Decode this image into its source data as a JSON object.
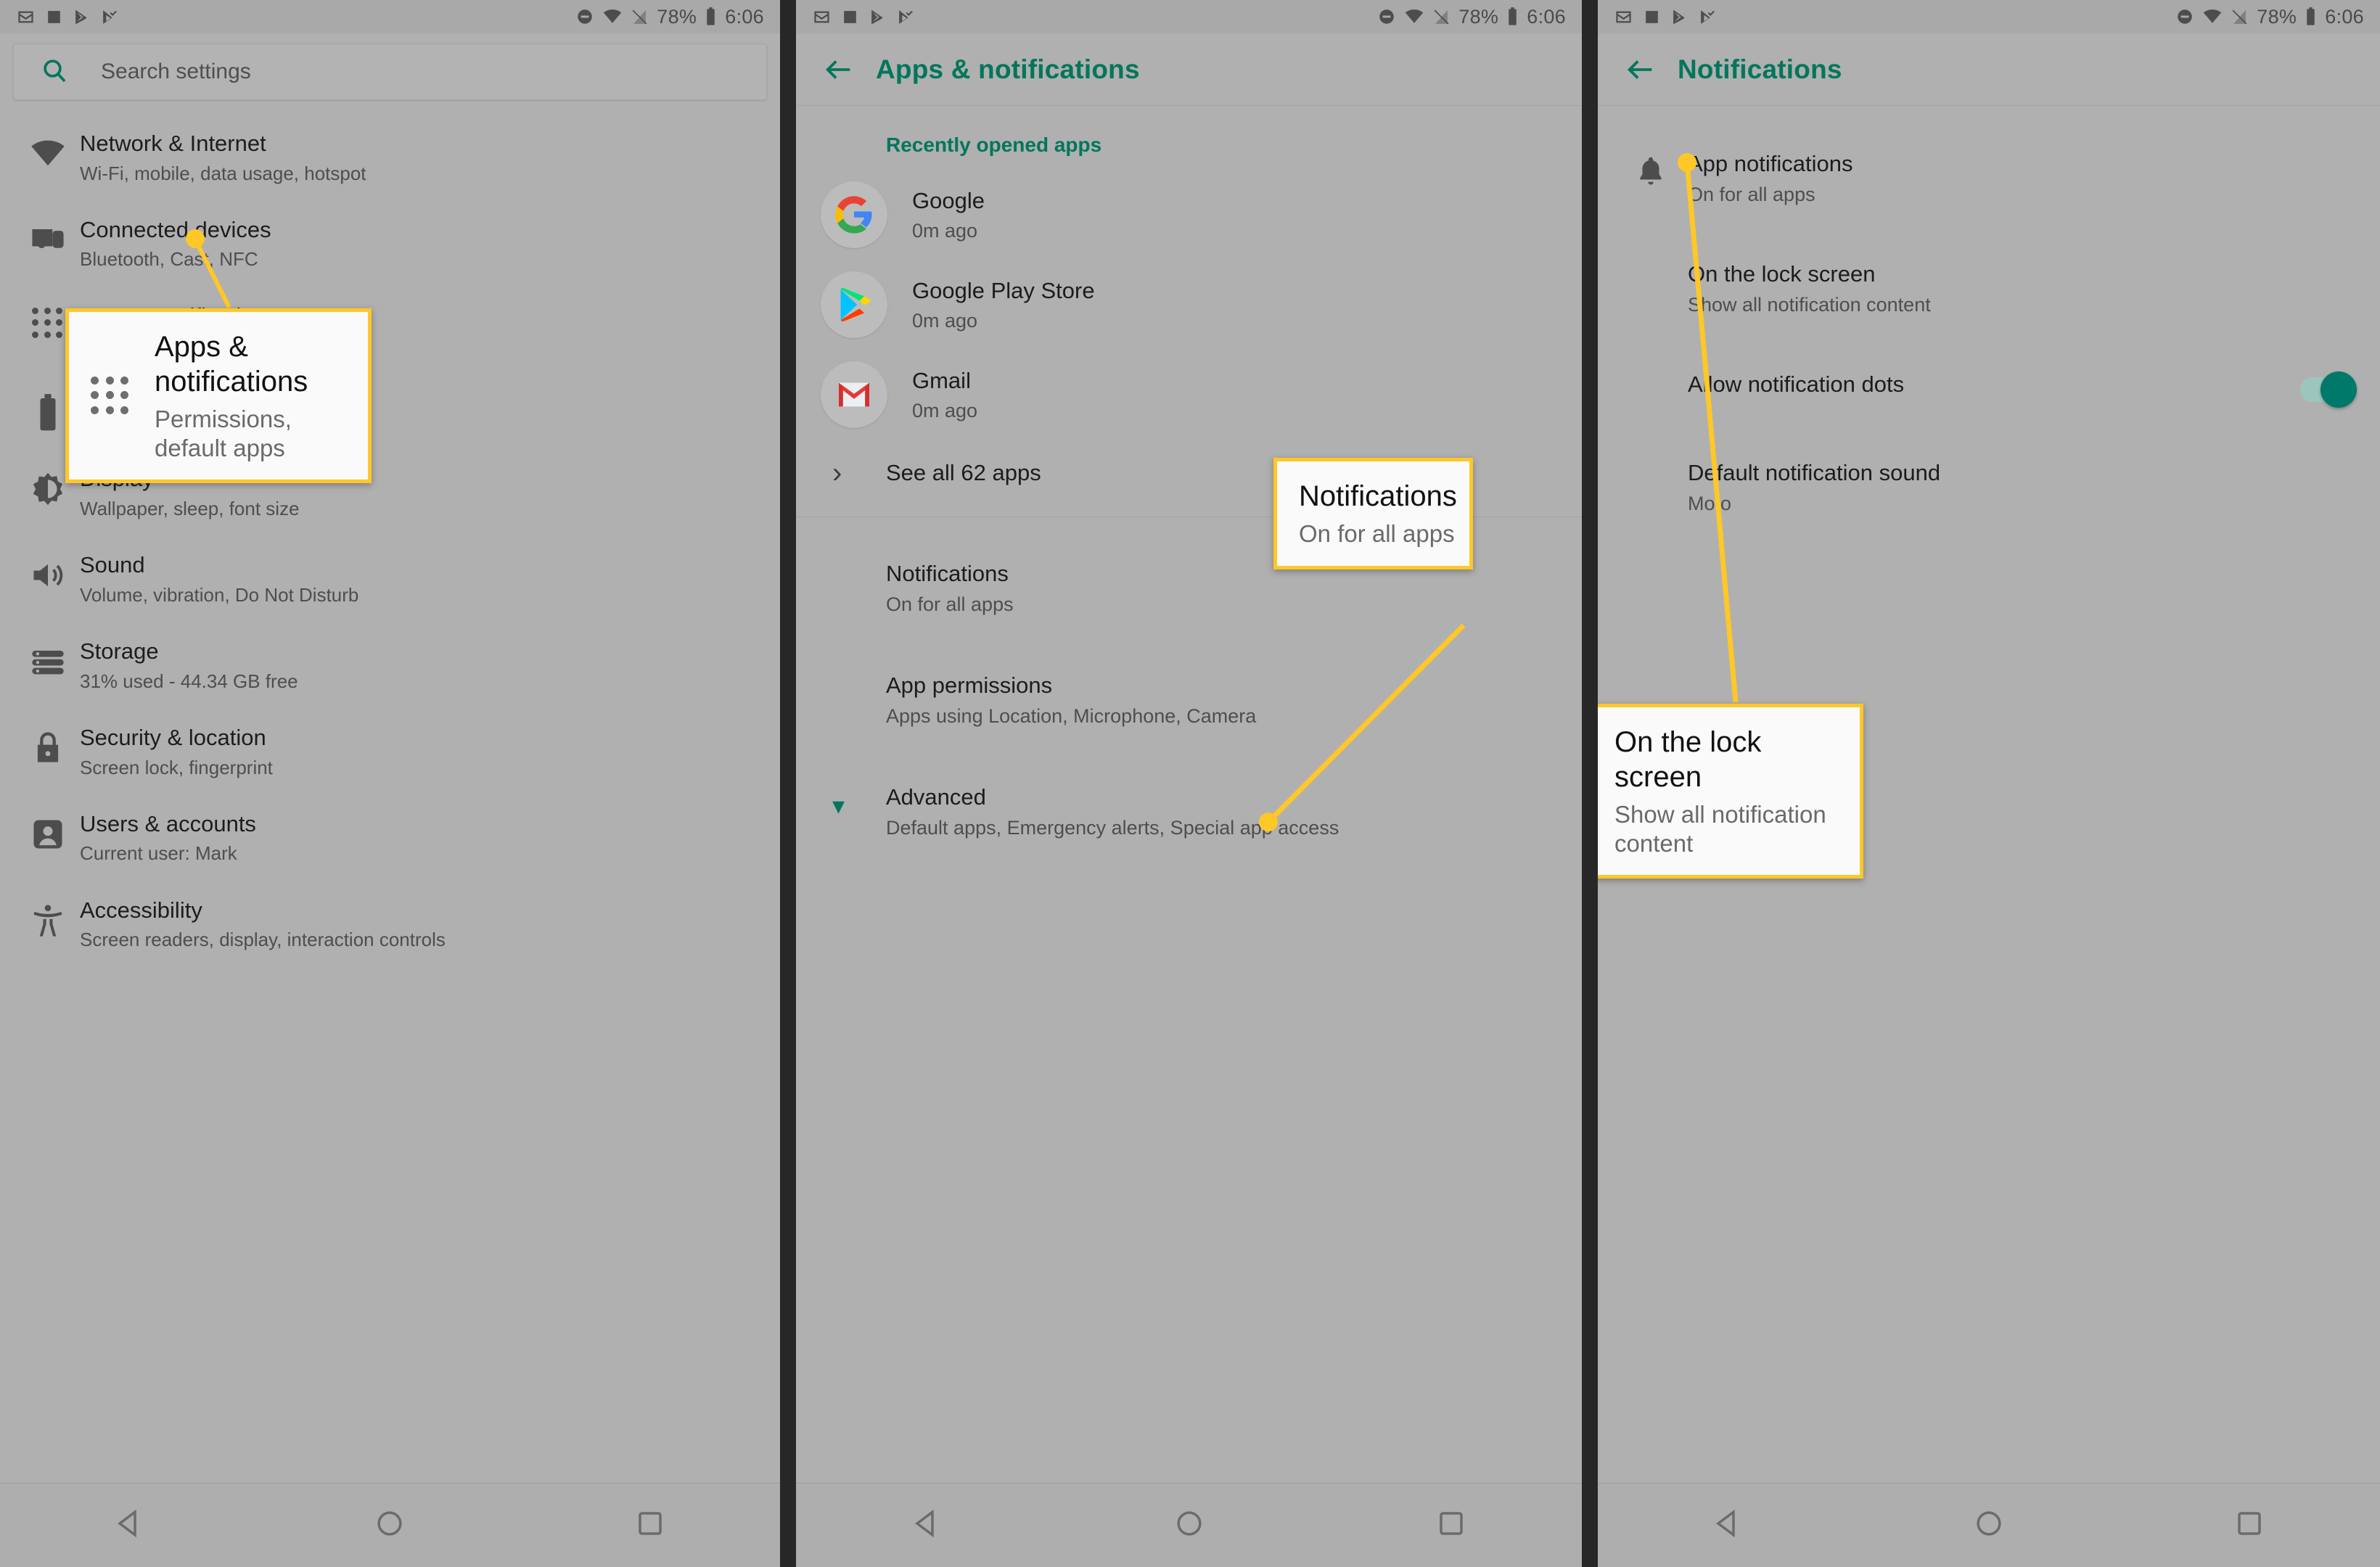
{
  "statusbar": {
    "left_icons": [
      "gmail-icon",
      "photos-icon",
      "play-store-icon",
      "play-movies-icon"
    ],
    "right_icons": [
      "do-not-disturb-icon",
      "wifi-icon",
      "signal-off-icon"
    ],
    "battery_percent": "78%",
    "battery_icon": "battery-icon",
    "time": "6:06"
  },
  "panel1": {
    "search": {
      "placeholder": "Search settings",
      "icon": "search-icon"
    },
    "items": [
      {
        "icon": "wifi-icon",
        "title": "Network & Internet",
        "sub": "Wi-Fi, mobile, data usage, hotspot"
      },
      {
        "icon": "devices-icon",
        "title": "Connected devices",
        "sub": "Bluetooth, Cast, NFC"
      },
      {
        "icon": "apps-grid-icon",
        "title": "Apps & notifications",
        "sub": "Permissions, default apps"
      },
      {
        "icon": "battery-icon",
        "title": "Battery",
        "sub": ""
      },
      {
        "icon": "brightness-icon",
        "title": "Display",
        "sub": "Wallpaper, sleep, font size"
      },
      {
        "icon": "volume-icon",
        "title": "Sound",
        "sub": "Volume, vibration, Do Not Disturb"
      },
      {
        "icon": "storage-icon",
        "title": "Storage",
        "sub": "31% used - 44.34 GB free"
      },
      {
        "icon": "lock-icon",
        "title": "Security & location",
        "sub": "Screen lock, fingerprint"
      },
      {
        "icon": "account-icon",
        "title": "Users & accounts",
        "sub": "Current user: Mark"
      },
      {
        "icon": "accessibility-icon",
        "title": "Accessibility",
        "sub": "Screen readers, display, interaction controls"
      }
    ],
    "callout": {
      "icon": "apps-grid-icon",
      "title": "Apps & notifications",
      "sub": "Permissions, default apps"
    }
  },
  "panel2": {
    "back_icon": "back-arrow-icon",
    "title": "Apps & notifications",
    "section_header": "Recently opened apps",
    "apps": [
      {
        "icon": "google-icon",
        "name": "Google",
        "time": "0m ago"
      },
      {
        "icon": "play-store-icon",
        "name": "Google Play Store",
        "time": "0m ago"
      },
      {
        "icon": "gmail-icon",
        "name": "Gmail",
        "time": "0m ago"
      }
    ],
    "see_all": {
      "label": "See all 62 apps",
      "icon": "chevron-right-icon"
    },
    "rows": [
      {
        "title": "Notifications",
        "sub": "On for all apps"
      },
      {
        "title": "App permissions",
        "sub": "Apps using Location, Microphone, Camera"
      }
    ],
    "advanced": {
      "icon": "chevron-down-icon",
      "title": "Advanced",
      "sub": "Default apps, Emergency alerts, Special app access"
    },
    "callout": {
      "title": "Notifications",
      "sub": "On for all apps"
    }
  },
  "panel3": {
    "back_icon": "back-arrow-icon",
    "title": "Notifications",
    "rows": [
      {
        "icon": "bell-icon",
        "title": "App notifications",
        "sub": "On for all apps",
        "toggle": false
      },
      {
        "icon": "",
        "title": "On the lock screen",
        "sub": "Show all notification content",
        "toggle": false
      },
      {
        "icon": "",
        "title": "Allow notification dots",
        "sub": "",
        "toggle": true
      },
      {
        "icon": "",
        "title": "Default notification sound",
        "sub": "Moto",
        "toggle": false
      }
    ],
    "callout": {
      "title": "On the lock screen",
      "sub": "Show all notification content"
    }
  },
  "navbar": {
    "back_icon": "nav-back-triangle-icon",
    "home_icon": "nav-home-circle-icon",
    "recents_icon": "nav-recents-square-icon"
  },
  "colors": {
    "accent_teal": "#00765c",
    "callout_yellow": "#ffc727",
    "toggle_on": "#00796b",
    "panel_bg": "#b0b0b0"
  }
}
